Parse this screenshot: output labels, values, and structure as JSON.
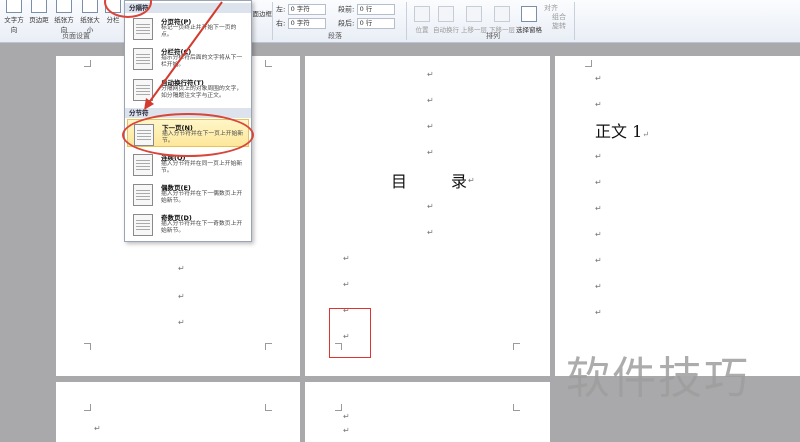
{
  "ribbon": {
    "buttons": [
      {
        "label": "文字方向"
      },
      {
        "label": "页边距"
      },
      {
        "label": "纸张方向"
      },
      {
        "label": "纸张大小"
      },
      {
        "label": "分栏"
      }
    ],
    "page_setup_label": "页面设置",
    "page_border_label": "页面边框",
    "indent": {
      "left_label": "左:",
      "left_value": "0 字符",
      "right_label": "右:",
      "right_value": "0 字符"
    },
    "spacing": {
      "before_label": "段前:",
      "before_value": "0 行",
      "after_label": "段后:",
      "after_value": "0 行"
    },
    "paragraph_label": "段落",
    "arrange_label": "排列",
    "arrange_buttons": [
      {
        "label": "位置"
      },
      {
        "label": "自动换行"
      },
      {
        "label": "上移一层"
      },
      {
        "label": "下移一层"
      },
      {
        "label": "选择窗格"
      }
    ],
    "align_label": "对齐",
    "group_label": "组合",
    "rotate_label": "旋转"
  },
  "menu": {
    "section1_title": "分隔符",
    "items1": [
      {
        "title": "分页符(P)",
        "desc": "标记一页终止并开始下一页的点。"
      },
      {
        "title": "分栏符(C)",
        "desc": "指示分栏符后面的文字将从下一栏开始。"
      },
      {
        "title": "自动换行符(T)",
        "desc": "分隔网页上的对象周围的文字，如分隔题注文字与正文。"
      }
    ],
    "section2_title": "分节符",
    "items2": [
      {
        "title": "下一页(N)",
        "desc": "插入分节符并在下一页上开始新节。"
      },
      {
        "title": "连续(O)",
        "desc": "插入分节符并在同一页上开始新节。"
      },
      {
        "title": "偶数页(E)",
        "desc": "插入分节符并在下一偶数页上开始新节。"
      },
      {
        "title": "奇数页(D)",
        "desc": "插入分节符并在下一奇数页上开始新节。"
      }
    ]
  },
  "document": {
    "toc_char1": "目",
    "toc_char2": "录",
    "body_heading": "正文 1",
    "para_mark": "↵"
  },
  "watermark": "软件技巧",
  "colors": {
    "annotation": "#d33b2f",
    "highlight": "#fde79a"
  }
}
